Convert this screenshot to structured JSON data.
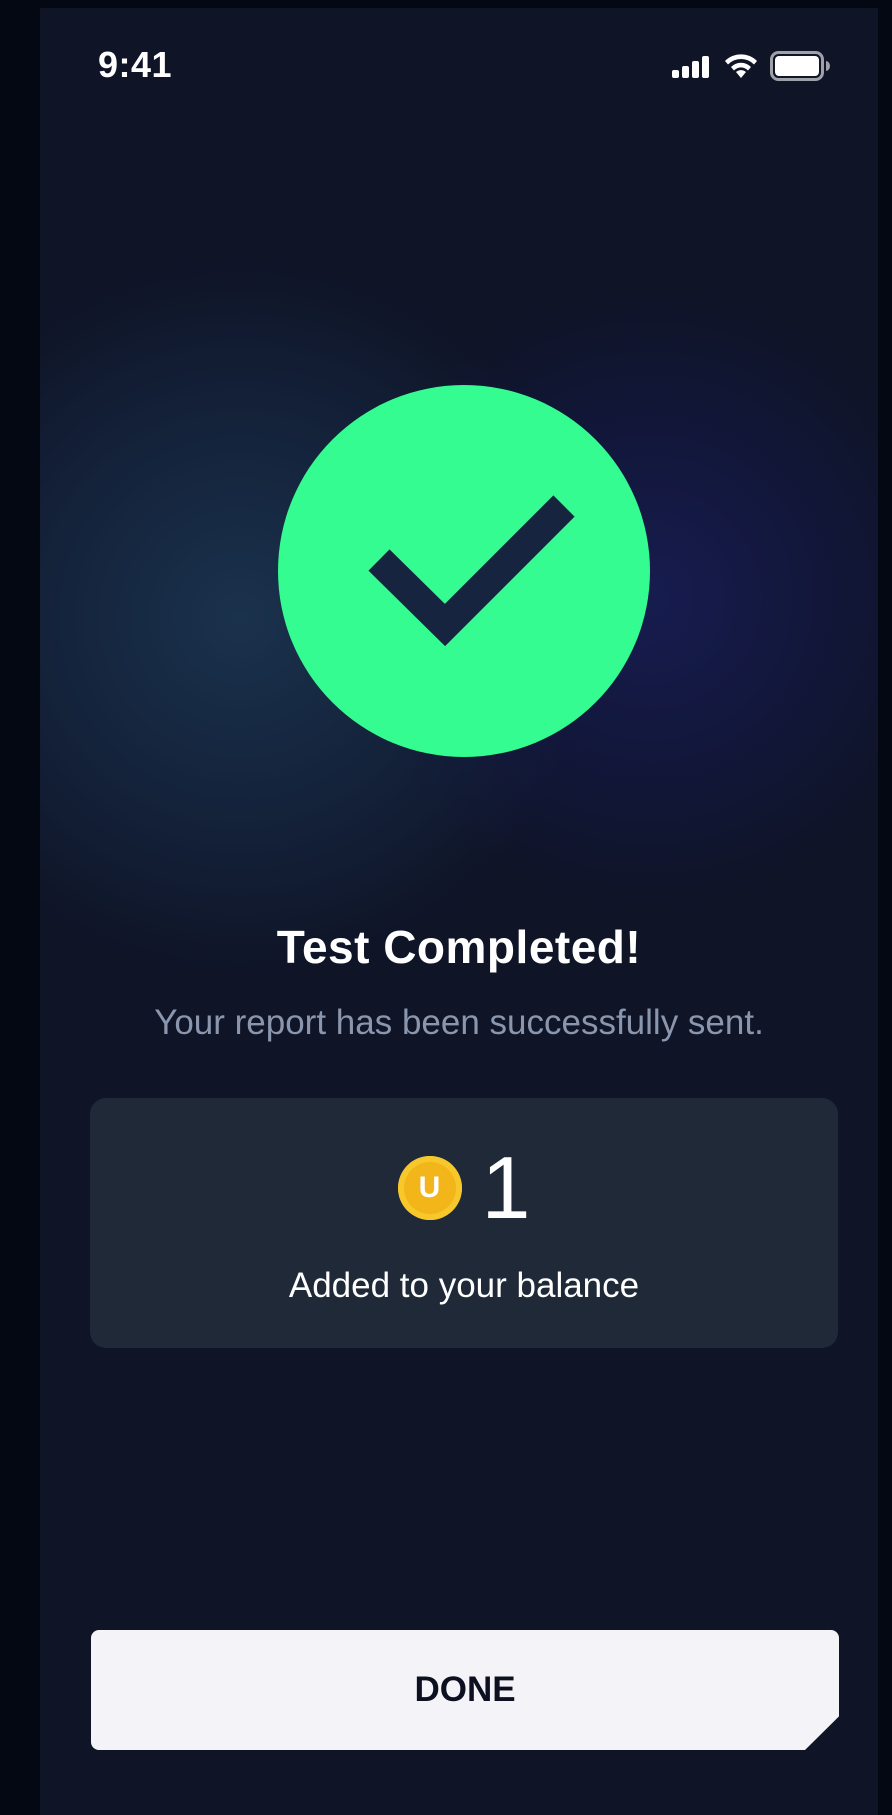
{
  "status_bar": {
    "time": "9:41",
    "icons": [
      "signal-icon",
      "wifi-icon",
      "battery-icon"
    ]
  },
  "success": {
    "icon": "checkmark-icon",
    "title": "Test Completed!",
    "subtitle": "Your report has been successfully sent."
  },
  "reward": {
    "coin_letter": "U",
    "amount": "1",
    "caption": "Added to your balance"
  },
  "actions": {
    "done_label": "DONE"
  },
  "colors": {
    "background": "#0f1427",
    "accent_green": "#34fc90",
    "card": "#1f2938",
    "coin": "#f2b51a",
    "button": "#f4f4f8"
  }
}
